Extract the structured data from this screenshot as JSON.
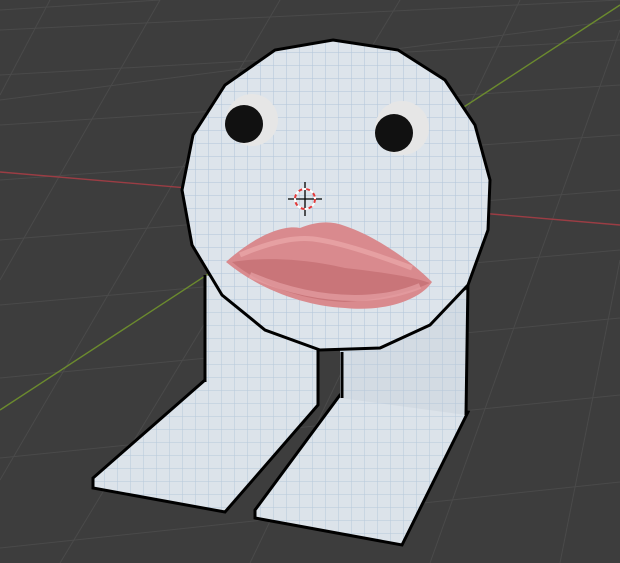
{
  "viewport": {
    "background": "#3d3d3d",
    "grid_line_color": "#4a4a4a",
    "x_axis_color": "#9b3d44",
    "y_axis_color": "#6b8a2e"
  },
  "model": {
    "body_color": "#dce3ea",
    "mesh_line_color": "#a9bfd6",
    "outline_color": "#000000",
    "eye_white_color": "#e8e8e8",
    "pupil_color": "#111111",
    "lip_color": "#d98a8e",
    "lip_highlight_color": "#e9a5a8",
    "lip_shadow_color": "#b86a70"
  },
  "cursor": {
    "name": "3d-cursor",
    "ring_colors": [
      "#e23a3a",
      "#ffffff"
    ]
  }
}
